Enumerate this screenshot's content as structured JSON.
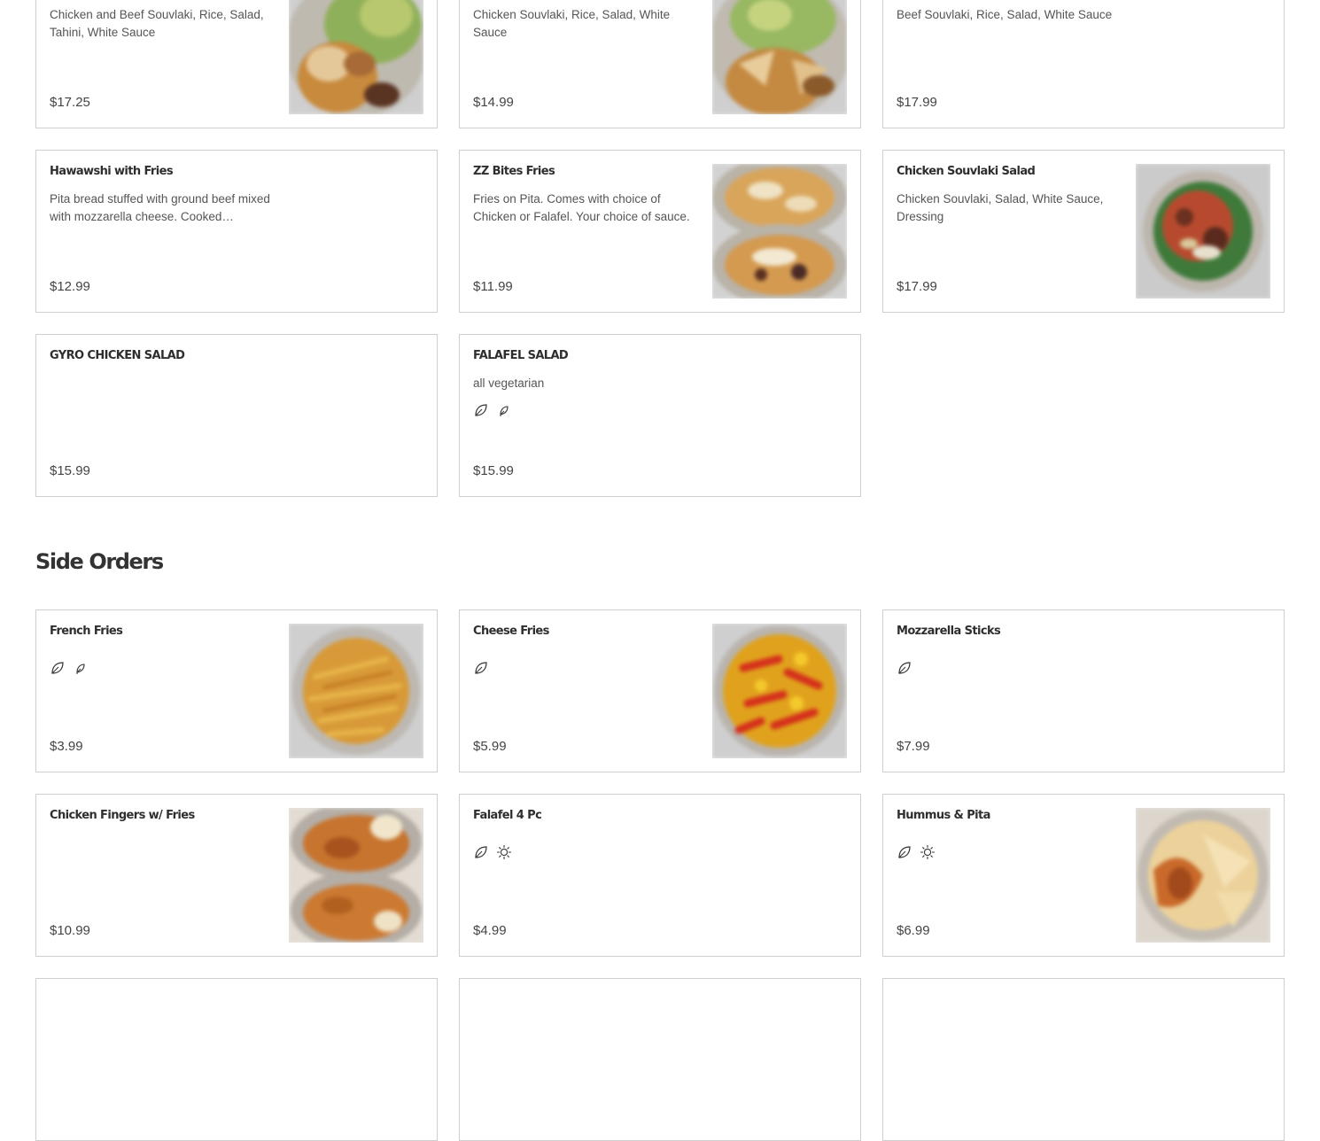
{
  "section_above": {
    "items": [
      {
        "name": "",
        "desc": "Chicken and Beef Souvlaki, Rice, Salad, Tahini, White Sauce",
        "price": "$17.25"
      },
      {
        "name": "",
        "desc": "Chicken Souvlaki, Rice, Salad, White Sauce",
        "price": "$14.99"
      },
      {
        "name": "",
        "desc": "Beef Souvlaki, Rice, Salad, White Sauce",
        "price": "$17.99"
      },
      {
        "name": "Hawawshi with Fries",
        "desc": "Pita bread stuffed with ground beef mixed with mozzarella cheese. Cooked…",
        "price": "$12.99"
      },
      {
        "name": "ZZ Bites Fries",
        "desc": "Fries on Pita. Comes with choice of Chicken or Falafel. Your choice of sauce.",
        "price": "$11.99"
      },
      {
        "name": "Chicken Souvlaki Salad",
        "desc": "Chicken Souvlaki, Salad, White Sauce, Dressing",
        "price": "$17.99"
      },
      {
        "name": "GYRO CHICKEN SALAD",
        "desc": "",
        "price": "$15.99"
      },
      {
        "name": "FALAFEL SALAD",
        "desc": "all vegetarian",
        "price": "$15.99",
        "badges": [
          "vegetarian-leaf-icon",
          "vegan-sprout-icon"
        ]
      }
    ]
  },
  "side_orders": {
    "title": "Side Orders",
    "items": [
      {
        "name": "French Fries",
        "price": "$3.99",
        "badges": [
          "vegetarian-leaf-icon",
          "vegan-sprout-icon"
        ]
      },
      {
        "name": "Cheese Fries",
        "price": "$5.99",
        "badges": [
          "vegetarian-leaf-icon"
        ]
      },
      {
        "name": "Mozzarella Sticks",
        "price": "$7.99",
        "badges": [
          "vegetarian-leaf-icon"
        ]
      },
      {
        "name": "Chicken Fingers w/ Fries",
        "price": "$10.99"
      },
      {
        "name": "Falafel 4 Pc",
        "price": "$4.99",
        "badges": [
          "vegetarian-leaf-icon",
          "spicy-sun-icon"
        ]
      },
      {
        "name": "Hummus & Pita",
        "price": "$6.99",
        "badges": [
          "vegetarian-leaf-icon",
          "spicy-sun-icon"
        ]
      }
    ]
  }
}
